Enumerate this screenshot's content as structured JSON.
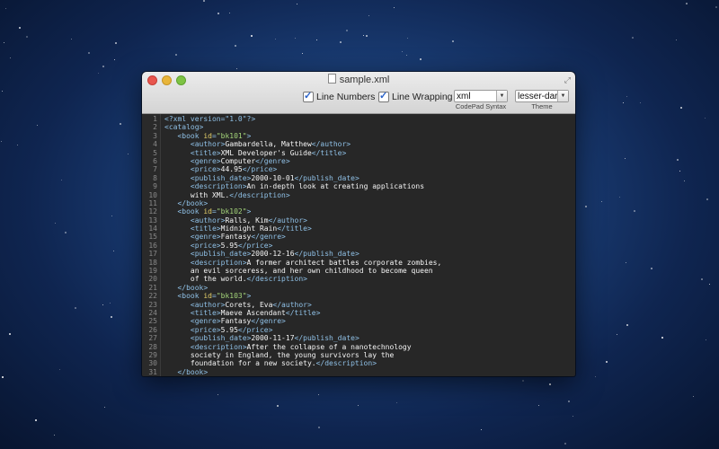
{
  "window": {
    "title": "sample.xml"
  },
  "toolbar": {
    "line_numbers_label": "Line Numbers",
    "line_wrapping_label": "Line Wrapping",
    "syntax_value": "xml",
    "syntax_caption": "CodePad Syntax",
    "theme_value": "lesser-dark",
    "theme_caption": "Theme"
  },
  "colors": {
    "tag": "#8fc0e6",
    "attr": "#e9d46b",
    "value": "#a5d67b",
    "background": "#272727"
  },
  "editor": {
    "line_numbers": [
      "1",
      "2",
      "3",
      "4",
      "5",
      "6",
      "7",
      "8",
      "9",
      "10",
      "11",
      "12",
      "13",
      "14",
      "15",
      "16",
      "17",
      "18",
      "19",
      "20",
      "21",
      "22",
      "23",
      "24",
      "25",
      "26",
      "27",
      "28",
      "29",
      "30",
      "31"
    ],
    "lines": [
      [
        {
          "c": "pi",
          "t": "<?xml version=\"1.0\"?>"
        }
      ],
      [
        {
          "c": "tag",
          "t": "<catalog>"
        }
      ],
      [
        {
          "c": "txt",
          "t": "   "
        },
        {
          "c": "tag",
          "t": "<book "
        },
        {
          "c": "attr",
          "t": "id"
        },
        {
          "c": "tag",
          "t": "="
        },
        {
          "c": "val",
          "t": "\"bk101\""
        },
        {
          "c": "tag",
          "t": ">"
        }
      ],
      [
        {
          "c": "txt",
          "t": "      "
        },
        {
          "c": "tag",
          "t": "<author>"
        },
        {
          "c": "txt",
          "t": "Gambardella, Matthew"
        },
        {
          "c": "tag",
          "t": "</author>"
        }
      ],
      [
        {
          "c": "txt",
          "t": "      "
        },
        {
          "c": "tag",
          "t": "<title>"
        },
        {
          "c": "txt",
          "t": "XML Developer's Guide"
        },
        {
          "c": "tag",
          "t": "</title>"
        }
      ],
      [
        {
          "c": "txt",
          "t": "      "
        },
        {
          "c": "tag",
          "t": "<genre>"
        },
        {
          "c": "txt",
          "t": "Computer"
        },
        {
          "c": "tag",
          "t": "</genre>"
        }
      ],
      [
        {
          "c": "txt",
          "t": "      "
        },
        {
          "c": "tag",
          "t": "<price>"
        },
        {
          "c": "txt",
          "t": "44.95"
        },
        {
          "c": "tag",
          "t": "</price>"
        }
      ],
      [
        {
          "c": "txt",
          "t": "      "
        },
        {
          "c": "tag",
          "t": "<publish_date>"
        },
        {
          "c": "txt",
          "t": "2000-10-01"
        },
        {
          "c": "tag",
          "t": "</publish_date>"
        }
      ],
      [
        {
          "c": "txt",
          "t": "      "
        },
        {
          "c": "tag",
          "t": "<description>"
        },
        {
          "c": "txt",
          "t": "An in-depth look at creating applications"
        }
      ],
      [
        {
          "c": "txt",
          "t": "      with XML."
        },
        {
          "c": "tag",
          "t": "</description>"
        }
      ],
      [
        {
          "c": "txt",
          "t": "   "
        },
        {
          "c": "tag",
          "t": "</book>"
        }
      ],
      [
        {
          "c": "txt",
          "t": "   "
        },
        {
          "c": "tag",
          "t": "<book "
        },
        {
          "c": "attr",
          "t": "id"
        },
        {
          "c": "tag",
          "t": "="
        },
        {
          "c": "val",
          "t": "\"bk102\""
        },
        {
          "c": "tag",
          "t": ">"
        }
      ],
      [
        {
          "c": "txt",
          "t": "      "
        },
        {
          "c": "tag",
          "t": "<author>"
        },
        {
          "c": "txt",
          "t": "Ralls, Kim"
        },
        {
          "c": "tag",
          "t": "</author>"
        }
      ],
      [
        {
          "c": "txt",
          "t": "      "
        },
        {
          "c": "tag",
          "t": "<title>"
        },
        {
          "c": "txt",
          "t": "Midnight Rain"
        },
        {
          "c": "tag",
          "t": "</title>"
        }
      ],
      [
        {
          "c": "txt",
          "t": "      "
        },
        {
          "c": "tag",
          "t": "<genre>"
        },
        {
          "c": "txt",
          "t": "Fantasy"
        },
        {
          "c": "tag",
          "t": "</genre>"
        }
      ],
      [
        {
          "c": "txt",
          "t": "      "
        },
        {
          "c": "tag",
          "t": "<price>"
        },
        {
          "c": "txt",
          "t": "5.95"
        },
        {
          "c": "tag",
          "t": "</price>"
        }
      ],
      [
        {
          "c": "txt",
          "t": "      "
        },
        {
          "c": "tag",
          "t": "<publish_date>"
        },
        {
          "c": "txt",
          "t": "2000-12-16"
        },
        {
          "c": "tag",
          "t": "</publish_date>"
        }
      ],
      [
        {
          "c": "txt",
          "t": "      "
        },
        {
          "c": "tag",
          "t": "<description>"
        },
        {
          "c": "txt",
          "t": "A former architect battles corporate zombies,"
        }
      ],
      [
        {
          "c": "txt",
          "t": "      an evil sorceress, and her own childhood to become queen"
        }
      ],
      [
        {
          "c": "txt",
          "t": "      of the world."
        },
        {
          "c": "tag",
          "t": "</description>"
        }
      ],
      [
        {
          "c": "txt",
          "t": "   "
        },
        {
          "c": "tag",
          "t": "</book>"
        }
      ],
      [
        {
          "c": "txt",
          "t": "   "
        },
        {
          "c": "tag",
          "t": "<book "
        },
        {
          "c": "attr",
          "t": "id"
        },
        {
          "c": "tag",
          "t": "="
        },
        {
          "c": "val",
          "t": "\"bk103\""
        },
        {
          "c": "tag",
          "t": ">"
        }
      ],
      [
        {
          "c": "txt",
          "t": "      "
        },
        {
          "c": "tag",
          "t": "<author>"
        },
        {
          "c": "txt",
          "t": "Corets, Eva"
        },
        {
          "c": "tag",
          "t": "</author>"
        }
      ],
      [
        {
          "c": "txt",
          "t": "      "
        },
        {
          "c": "tag",
          "t": "<title>"
        },
        {
          "c": "txt",
          "t": "Maeve Ascendant"
        },
        {
          "c": "tag",
          "t": "</title>"
        }
      ],
      [
        {
          "c": "txt",
          "t": "      "
        },
        {
          "c": "tag",
          "t": "<genre>"
        },
        {
          "c": "txt",
          "t": "Fantasy"
        },
        {
          "c": "tag",
          "t": "</genre>"
        }
      ],
      [
        {
          "c": "txt",
          "t": "      "
        },
        {
          "c": "tag",
          "t": "<price>"
        },
        {
          "c": "txt",
          "t": "5.95"
        },
        {
          "c": "tag",
          "t": "</price>"
        }
      ],
      [
        {
          "c": "txt",
          "t": "      "
        },
        {
          "c": "tag",
          "t": "<publish_date>"
        },
        {
          "c": "txt",
          "t": "2000-11-17"
        },
        {
          "c": "tag",
          "t": "</publish_date>"
        }
      ],
      [
        {
          "c": "txt",
          "t": "      "
        },
        {
          "c": "tag",
          "t": "<description>"
        },
        {
          "c": "txt",
          "t": "After the collapse of a nanotechnology"
        }
      ],
      [
        {
          "c": "txt",
          "t": "      society in England, the young survivors lay the"
        }
      ],
      [
        {
          "c": "txt",
          "t": "      foundation for a new society."
        },
        {
          "c": "tag",
          "t": "</description>"
        }
      ],
      [
        {
          "c": "txt",
          "t": "   "
        },
        {
          "c": "tag",
          "t": "</book>"
        }
      ]
    ]
  }
}
